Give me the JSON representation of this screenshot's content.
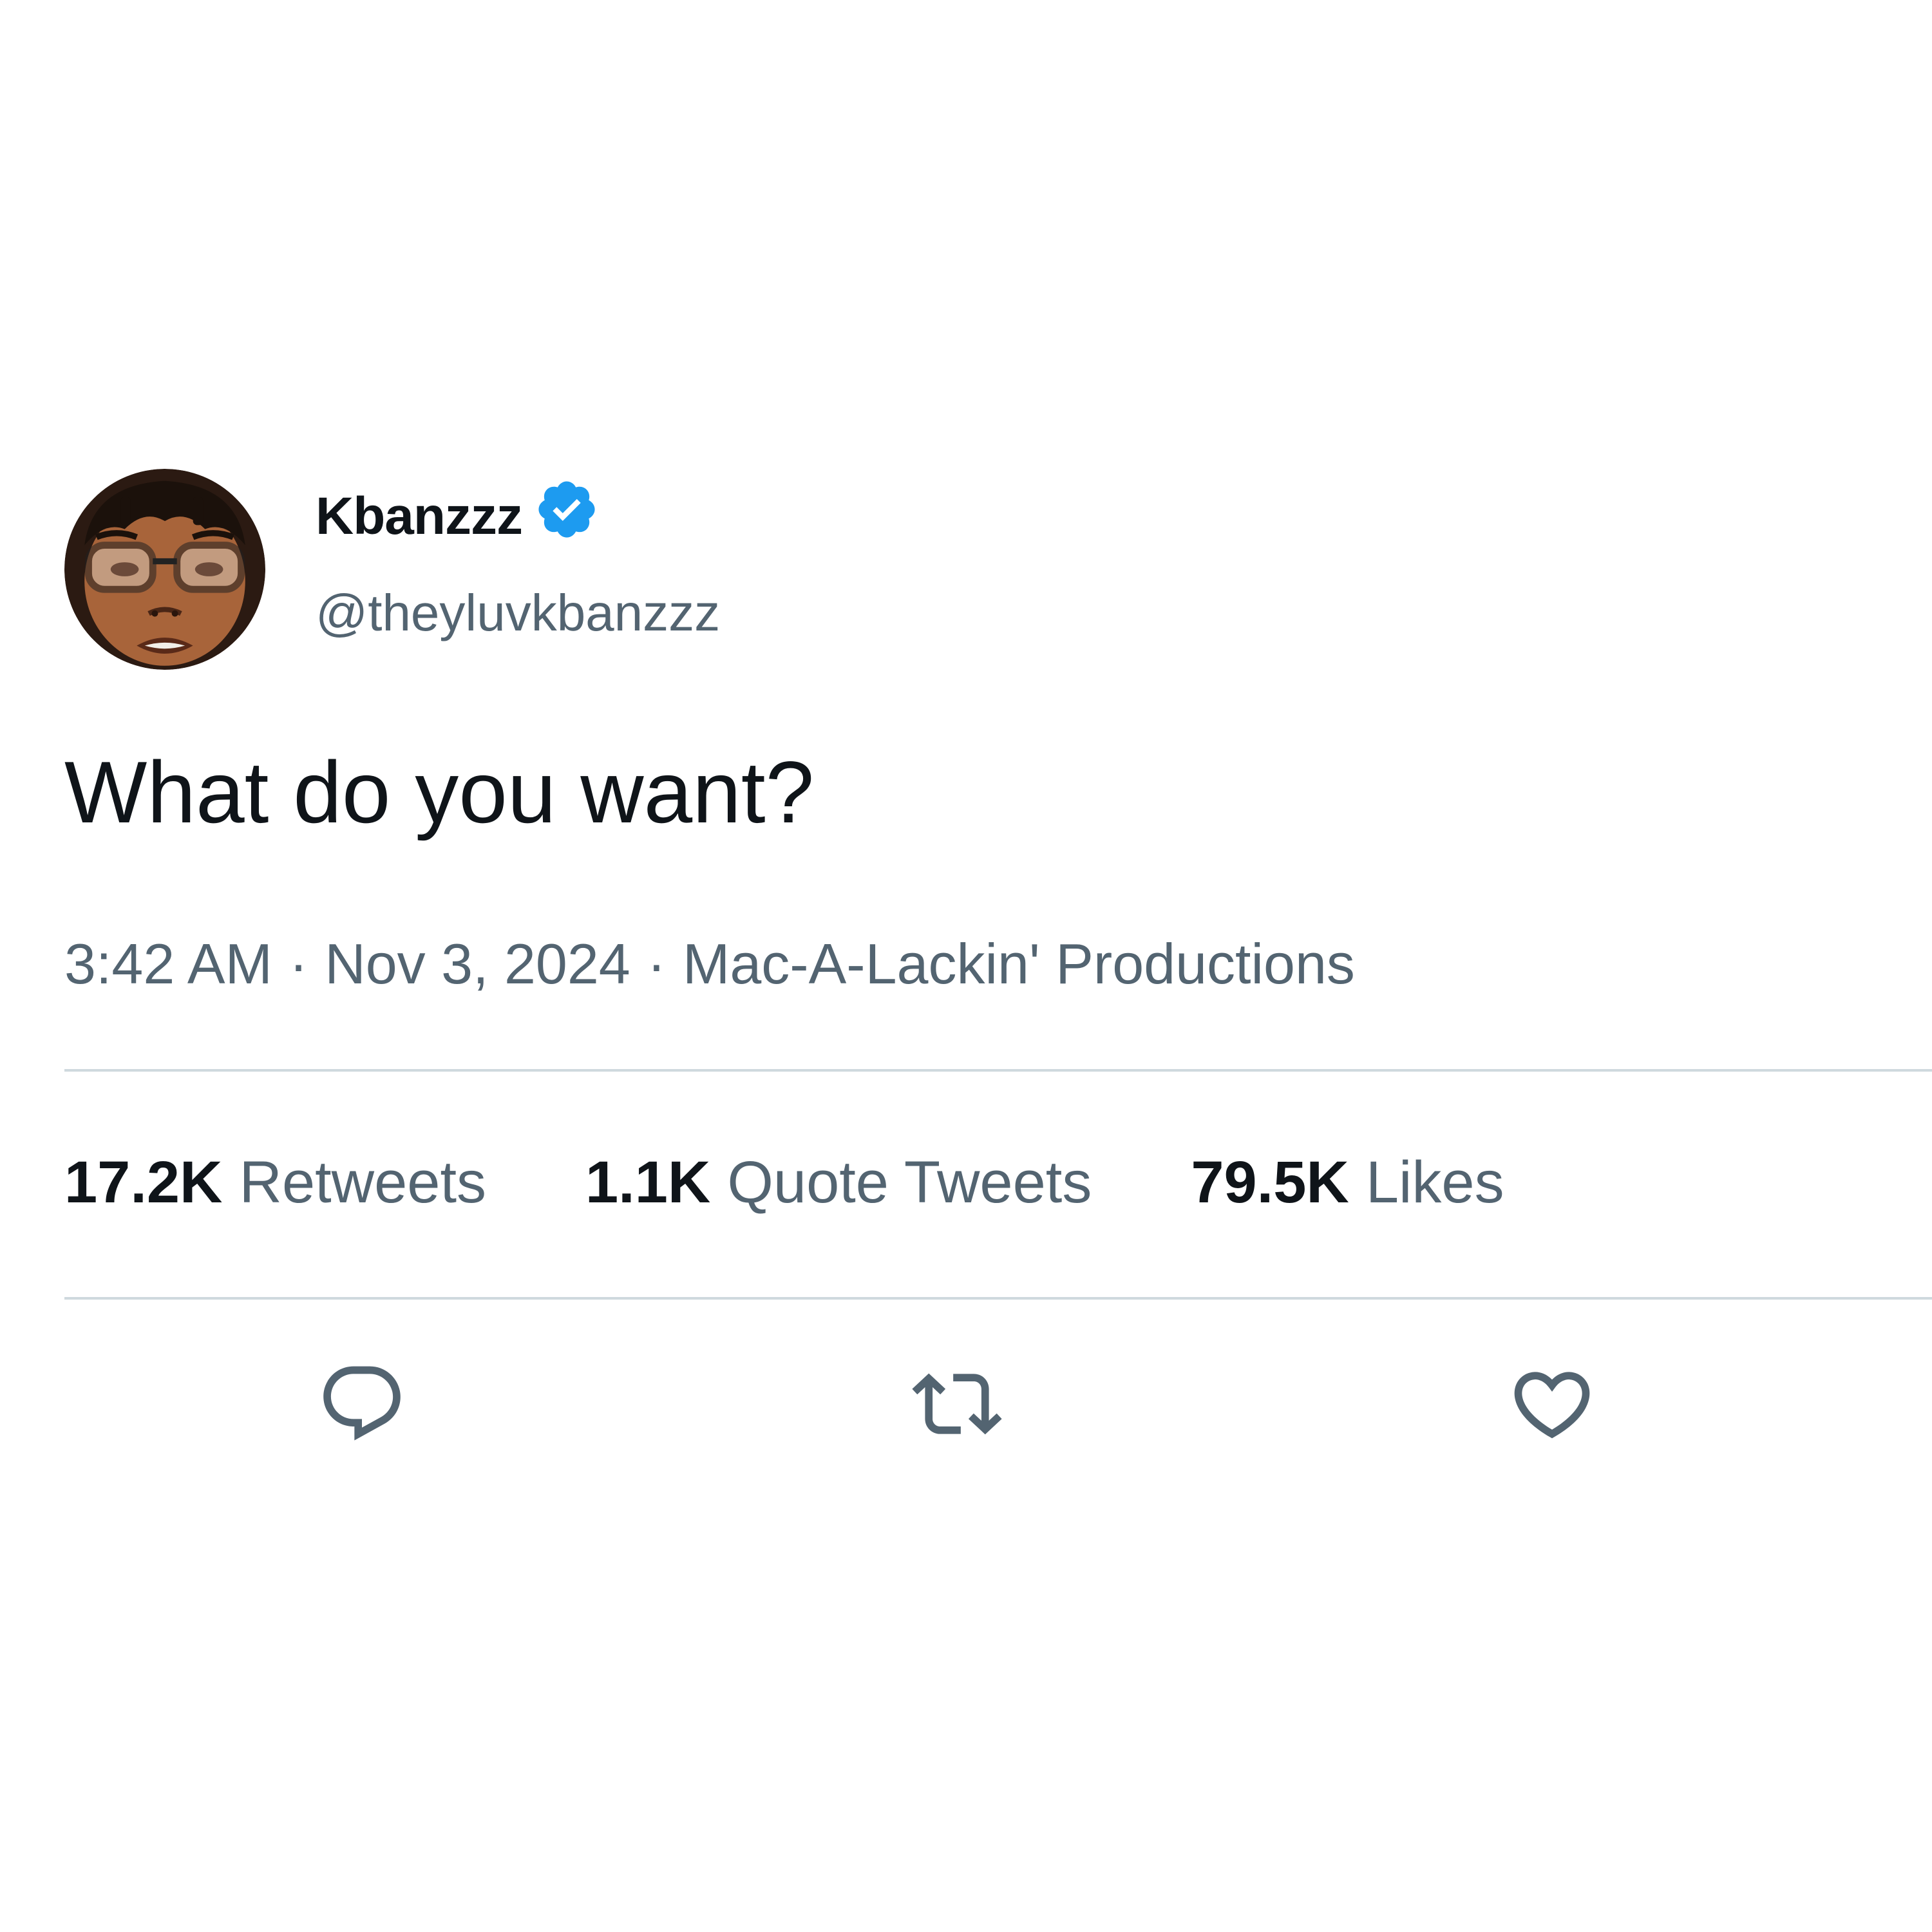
{
  "tweet": {
    "author": {
      "display_name": "Kbanzzz",
      "handle": "@theyluvkbanzzz",
      "verified_icon": "verified-badge-icon",
      "avatar": "cartoon-avatar"
    },
    "text": "What do you want?",
    "meta": {
      "time": "3:42 AM",
      "separator": "·",
      "date": "Nov 3, 2024",
      "source": "Mac-A-Lackin' Productions"
    },
    "stats": [
      {
        "value": "17.2K",
        "label": "Retweets"
      },
      {
        "value": "1.1K",
        "label": "Quote Tweets"
      },
      {
        "value": "79.5K",
        "label": "Likes"
      }
    ],
    "actions": [
      {
        "icon": "reply-icon"
      },
      {
        "icon": "retweet-icon"
      },
      {
        "icon": "like-icon"
      }
    ]
  },
  "colors": {
    "text_primary": "#0f1419",
    "text_secondary": "#536471",
    "verified_blue": "#1d9bf0",
    "divider": "#cfd9de",
    "icon": "#536471",
    "background": "#ffffff"
  }
}
